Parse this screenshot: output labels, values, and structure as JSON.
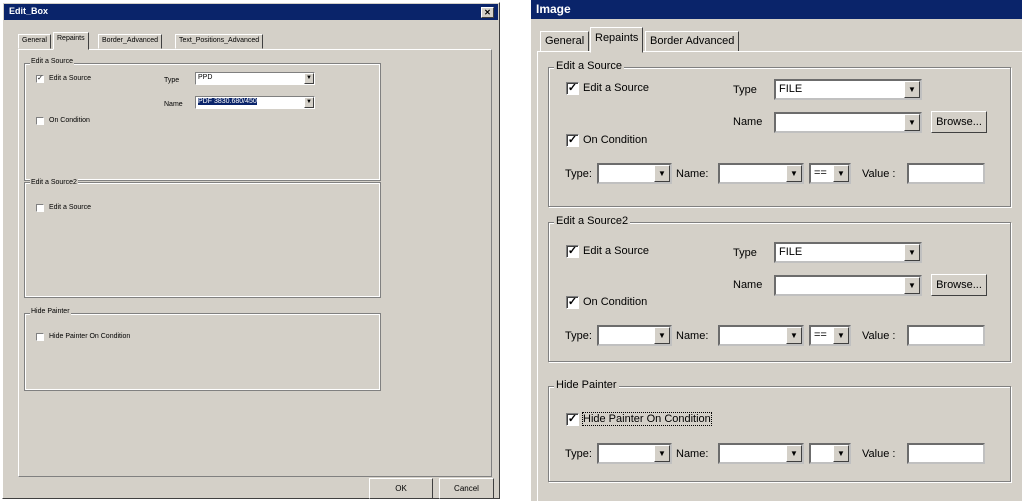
{
  "left_dialog": {
    "title": "Edit_Box",
    "close_glyph": "✕",
    "tabs": [
      "General",
      "Repaints",
      "Border_Advanced",
      "Text_Positions_Advanced"
    ],
    "group1": {
      "label": "Edit a Source",
      "checkbox_edit_source": {
        "label": "Edit a Source",
        "checked": "✓"
      },
      "type_label": "Type",
      "type_value": "PPD",
      "name_label": "Name",
      "name_value": "PDF 3830.680/450",
      "checkbox_on_condition": {
        "label": "On Condition",
        "checked": ""
      }
    },
    "group2": {
      "label": "Edit a Source2",
      "checkbox_edit_source": {
        "label": "Edit a Source",
        "checked": ""
      }
    },
    "group3": {
      "label": "Hide Painter",
      "checkbox_hide_painter": {
        "label": "Hide Painter On Condition",
        "checked": ""
      }
    },
    "ok_label": "OK",
    "cancel_label": "Cancel"
  },
  "right_dialog": {
    "title": "Image",
    "tabs": [
      "General",
      "Repaints",
      "Border Advanced"
    ],
    "group1": {
      "label": "Edit a Source",
      "checkbox_edit_source": {
        "label": "Edit a Source",
        "checked": "✓"
      },
      "type_label": "Type",
      "type_value": "FILE",
      "name_label": "Name",
      "name_value": "",
      "browse_label": "Browse...",
      "checkbox_on_condition": {
        "label": "On Condition",
        "checked": "✓"
      },
      "cond_type_label": "Type:",
      "cond_name_label": "Name:",
      "operator_value": "==",
      "value_label": "Value :"
    },
    "group2": {
      "label": "Edit a Source2",
      "checkbox_edit_source": {
        "label": "Edit a Source",
        "checked": "✓"
      },
      "type_label": "Type",
      "type_value": "FILE",
      "name_label": "Name",
      "name_value": "",
      "browse_label": "Browse...",
      "checkbox_on_condition": {
        "label": "On Condition",
        "checked": "✓"
      },
      "cond_type_label": "Type:",
      "cond_name_label": "Name:",
      "operator_value": "==",
      "value_label": "Value :"
    },
    "group3": {
      "label": "Hide Painter",
      "checkbox_hide_painter": {
        "label": "Hide Painter On Condition",
        "checked": "✓"
      },
      "cond_type_label": "Type:",
      "cond_name_label": "Name:",
      "operator_value": "",
      "value_label": "Value :"
    },
    "dropdown_glyph": "▼"
  },
  "colors": {
    "title_bar": "#0a246a",
    "face": "#d4d0c8",
    "shadow": "#808080",
    "highlight": "#ffffff"
  }
}
